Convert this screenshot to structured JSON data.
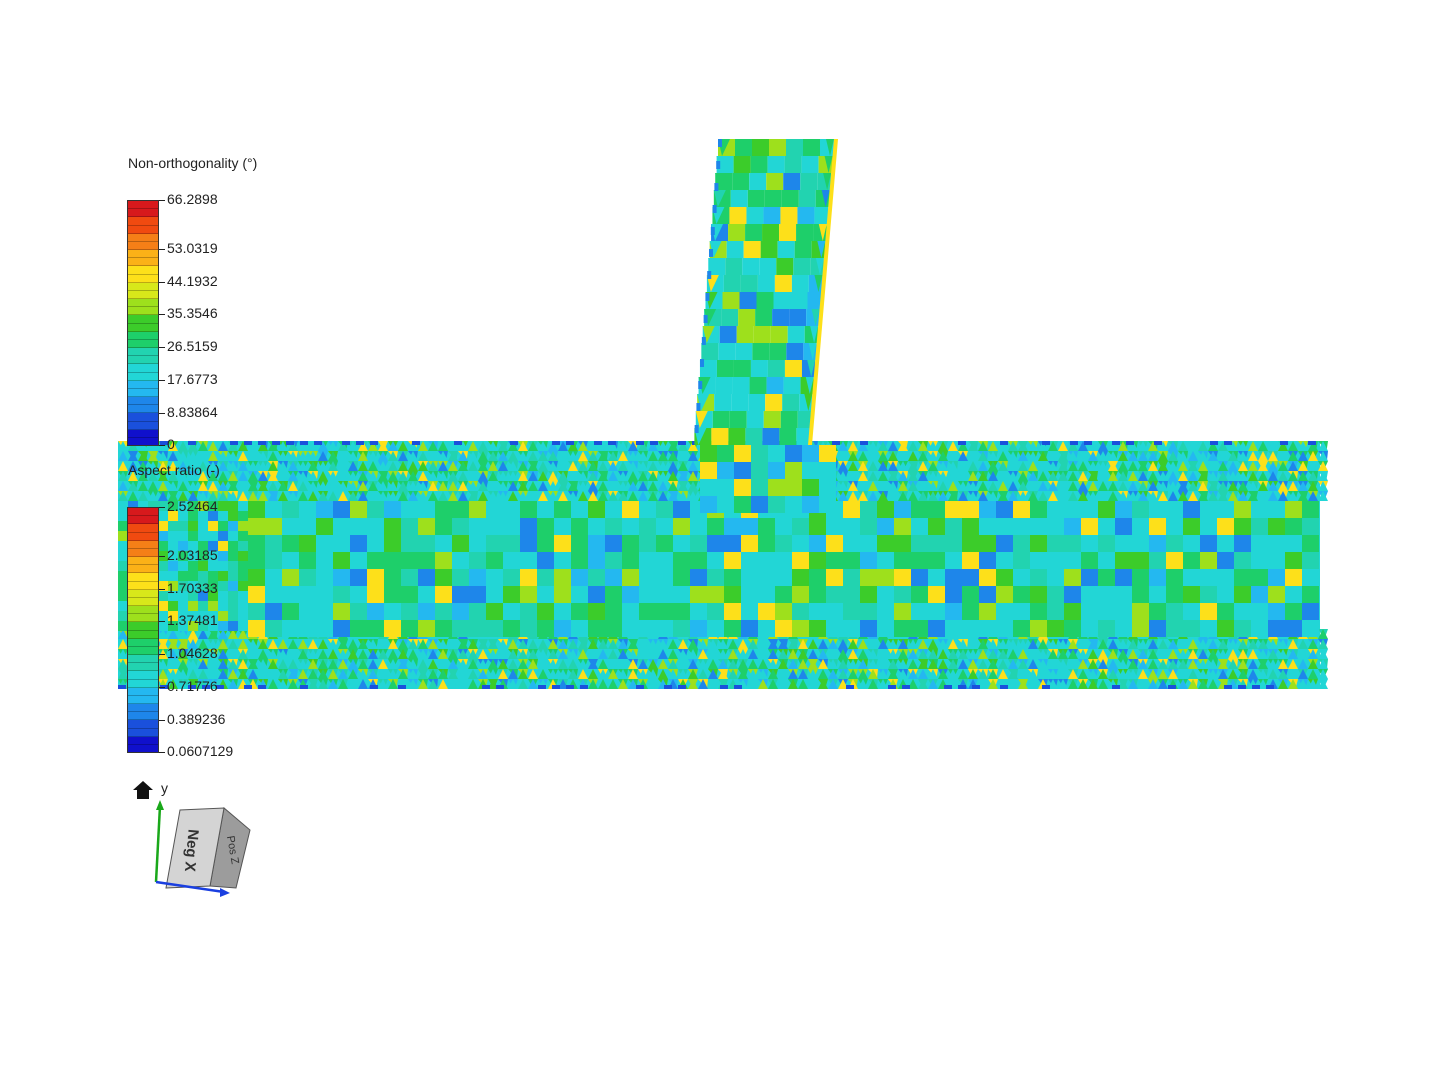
{
  "legend_nonortho": {
    "title": "Non-orthogonality (°)",
    "ticks": [
      "66.2898",
      "53.0319",
      "44.1932",
      "35.3546",
      "26.5159",
      "17.6773",
      "8.83864",
      "0"
    ]
  },
  "legend_aspect": {
    "title": "Aspect ratio (-)",
    "ticks": [
      "2.52464",
      "2.03185",
      "1.70333",
      "1.37481",
      "1.04628",
      "0.71776",
      "0.389236",
      "0.0607129"
    ]
  },
  "colormap": [
    "#d7191c",
    "#f04a10",
    "#f57f17",
    "#fbb117",
    "#fde01a",
    "#d8e81a",
    "#9ee01c",
    "#3ccc2a",
    "#1ecf6a",
    "#22d3b0",
    "#22d6d6",
    "#24b8f0",
    "#1e86ea",
    "#1a50dc",
    "#1010cc"
  ],
  "orientation": {
    "up_axis": "y",
    "face_front": "Neg X",
    "face_side": "Pos Z",
    "axis_x_color": "#1a3fe0",
    "axis_y_color": "#1aa81a"
  }
}
